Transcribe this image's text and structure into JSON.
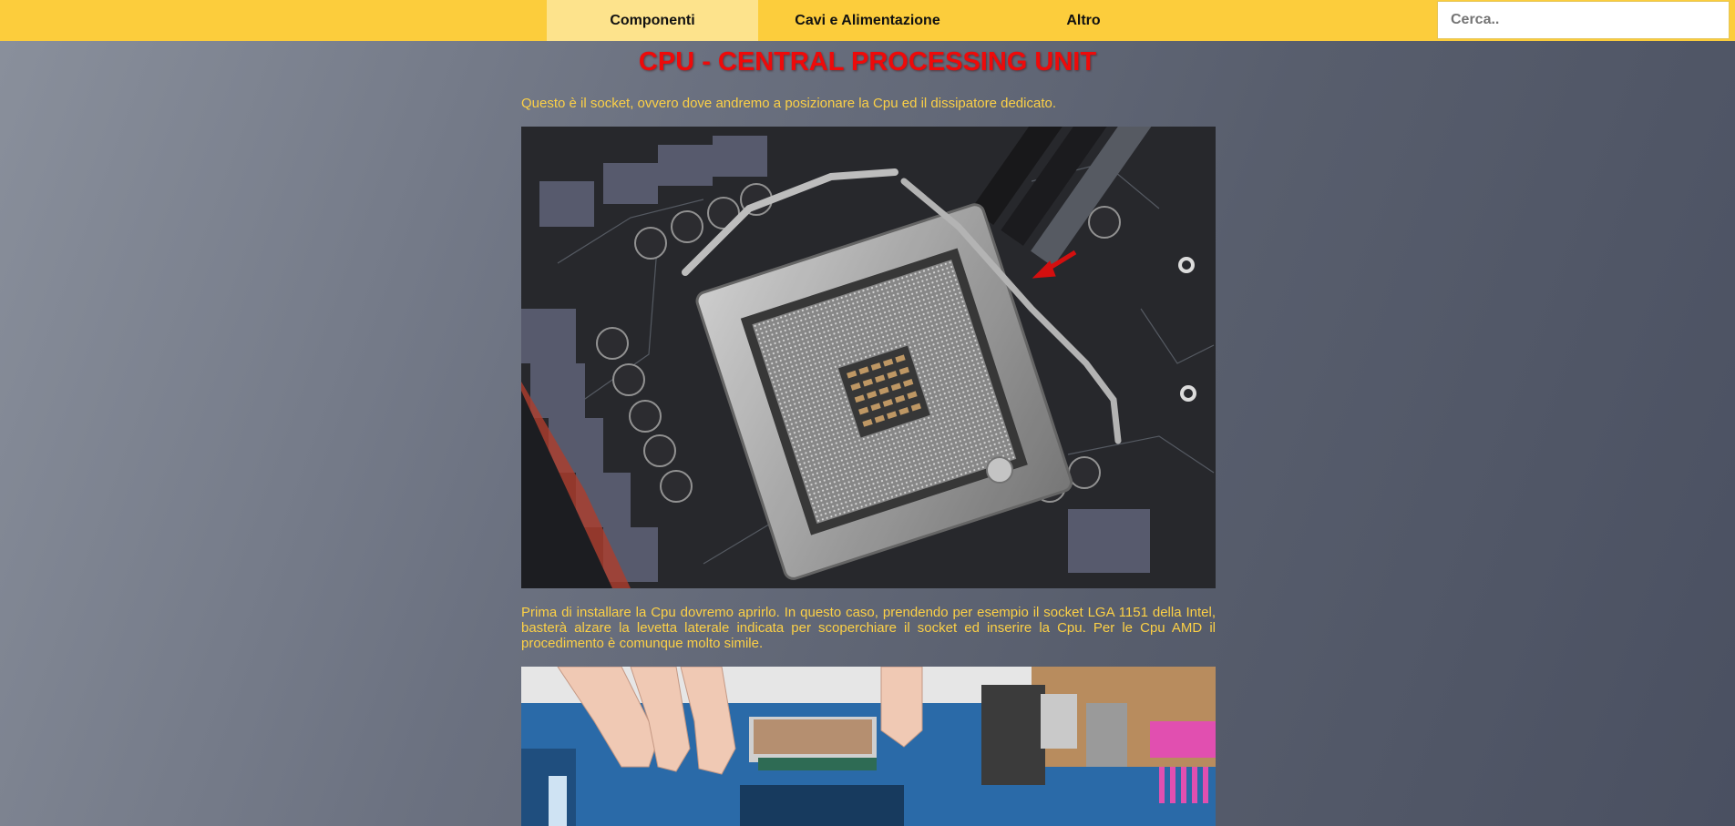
{
  "nav": {
    "items": [
      {
        "label": "Componenti",
        "active": true
      },
      {
        "label": "Cavi e Alimentazione",
        "active": false
      },
      {
        "label": "Altro",
        "active": false
      }
    ],
    "search_placeholder": "Cerca.."
  },
  "content": {
    "title": "CPU - CENTRAL PROCESSING UNIT",
    "paragraph_1": "Questo è il socket, ovvero dove andremo a posizionare la Cpu ed il dissipatore dedicato.",
    "paragraph_2": "Prima di installare la Cpu dovremo aprirlo. In questo caso, prendendo per esempio il socket LGA 1151 della Intel, basterà alzare la levetta laterale indicata per scoperchiare il socket ed inserire la Cpu. Per le Cpu AMD il procedimento è comunque molto simile."
  },
  "colors": {
    "navbar": "#fccd3c",
    "nav_active": "#fde38c",
    "title": "#ee0a0a",
    "text": "#fcd046"
  }
}
